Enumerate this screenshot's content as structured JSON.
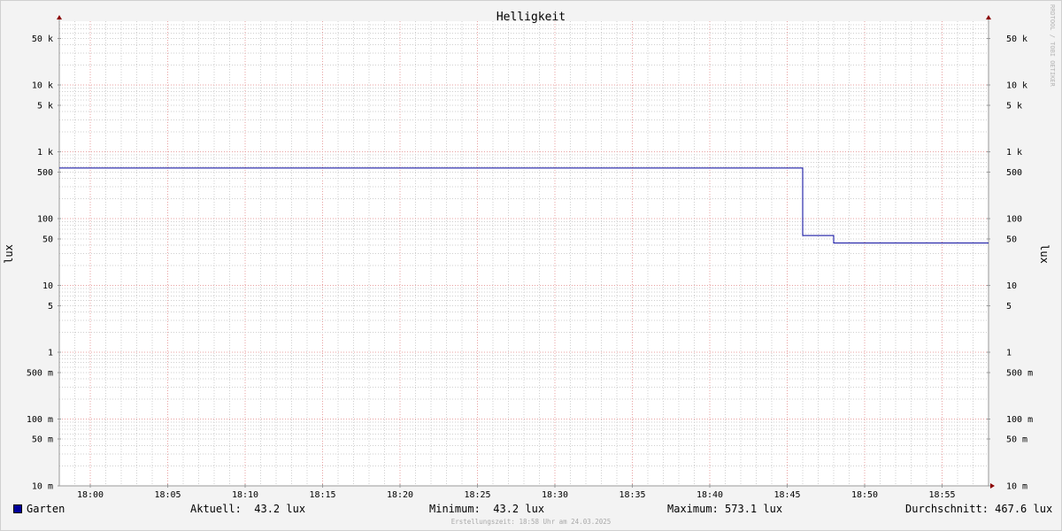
{
  "chart_data": {
    "type": "line",
    "title": "Helligkeit",
    "ylabel_left": "lux",
    "ylabel_right": "lux",
    "y_scale": "log",
    "ylim": [
      0.01,
      80000
    ],
    "xlim": [
      "17:58",
      "18:58"
    ],
    "grid": true,
    "x_ticks": [
      "18:00",
      "18:05",
      "18:10",
      "18:15",
      "18:20",
      "18:25",
      "18:30",
      "18:35",
      "18:40",
      "18:45",
      "18:50",
      "18:55"
    ],
    "y_ticks": [
      {
        "value": 50000,
        "label": "50 k"
      },
      {
        "value": 10000,
        "label": "10 k"
      },
      {
        "value": 5000,
        "label": "5 k"
      },
      {
        "value": 1000,
        "label": "1 k"
      },
      {
        "value": 500,
        "label": "500"
      },
      {
        "value": 100,
        "label": "100"
      },
      {
        "value": 50,
        "label": "50"
      },
      {
        "value": 10,
        "label": "10"
      },
      {
        "value": 5,
        "label": "5"
      },
      {
        "value": 1,
        "label": "1"
      },
      {
        "value": 0.5,
        "label": "500 m"
      },
      {
        "value": 0.1,
        "label": "100 m"
      },
      {
        "value": 0.05,
        "label": "50 m"
      },
      {
        "value": 0.01,
        "label": "10 m"
      }
    ],
    "series": [
      {
        "name": "Garten",
        "color": "#00009b",
        "points": [
          {
            "x": "17:58",
            "y": 573.1
          },
          {
            "x": "18:46",
            "y": 573.1
          },
          {
            "x": "18:46",
            "y": 56.0
          },
          {
            "x": "18:48",
            "y": 56.0
          },
          {
            "x": "18:48",
            "y": 43.2
          },
          {
            "x": "18:58",
            "y": 43.2
          }
        ]
      }
    ]
  },
  "legend": {
    "series_name": "Garten",
    "current": "Aktuell:  43.2 lux",
    "minimum": "Minimum:  43.2 lux",
    "maximum": "Maximum: 573.1 lux",
    "average": "Durchschnitt: 467.6 lux"
  },
  "footer": "Erstellungszeit: 18:58 Uhr am 24.03.2025",
  "watermark": "RRDTOOL / TOBI OETIKER",
  "colors": {
    "series": "#00009b",
    "major_grid": "#e8a0a0",
    "minor_grid": "#cfcfcf",
    "axis_arrow": "#8b0000"
  }
}
